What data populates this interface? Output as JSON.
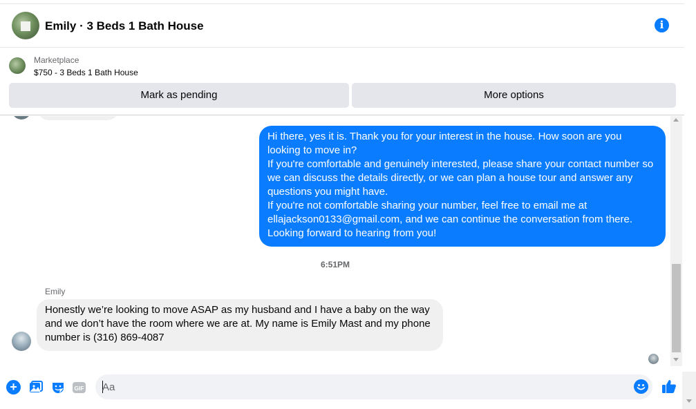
{
  "header": {
    "title": "Emily · 3 Beds 1 Bath House",
    "info_icon": "info-icon",
    "info_glyph": "i"
  },
  "listing": {
    "category": "Marketplace",
    "item": "$750 - 3 Beds 1 Bath House",
    "buttons": {
      "pending": "Mark as pending",
      "more": "More options"
    }
  },
  "conversation": {
    "outgoing": {
      "paragraphs": [
        "Hi there, yes it is. Thank you for your interest in the house. How soon are you looking to move in?",
        "If you're comfortable and genuinely interested, please share your contact number so we can discuss the details directly, or we can plan a house tour and answer any questions you might have.",
        "If you're not comfortable sharing your number, feel free to email me at ellajackson0133@gmail.com, and we can continue the conversation from there. Looking forward to hearing from you!"
      ]
    },
    "timestamp": "6:51PM",
    "incoming": {
      "sender": "Emily",
      "text": "Honestly we’re looking to move ASAP as my husband and I have a baby on the way and we don’t have the room where we are at. My name is Emily Mast and my phone number is (316) 869-4087"
    }
  },
  "composer": {
    "placeholder": "Aa",
    "icons": [
      "plus-icon",
      "photo-icon",
      "sticker-icon",
      "gif-icon",
      "emoji-icon",
      "thumbs-up-icon"
    ],
    "gif_label": "GIF"
  },
  "colors": {
    "accent": "#0a7cff",
    "bubble_in": "#f0f0f0",
    "button_bg": "#e4e6eb",
    "secondary_text": "#65676b"
  }
}
